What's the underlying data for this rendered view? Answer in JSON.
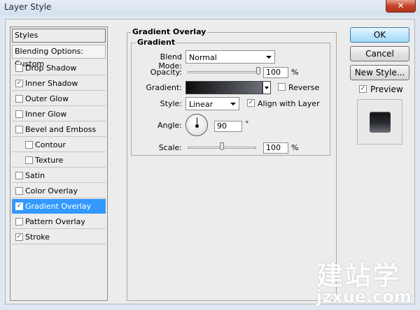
{
  "window": {
    "title": "Layer Style",
    "close_glyph": "✕"
  },
  "styles_list": {
    "header": "Styles",
    "blending_options": "Blending Options: Custom",
    "items": [
      {
        "label": "Drop Shadow",
        "checked": false,
        "selected": false
      },
      {
        "label": "Inner Shadow",
        "checked": true,
        "selected": false
      },
      {
        "label": "Outer Glow",
        "checked": false,
        "selected": false
      },
      {
        "label": "Inner Glow",
        "checked": false,
        "selected": false
      },
      {
        "label": "Bevel and Emboss",
        "checked": false,
        "selected": false
      },
      {
        "label": "Contour",
        "checked": false,
        "selected": false,
        "indent": true
      },
      {
        "label": "Texture",
        "checked": false,
        "selected": false,
        "indent": true
      },
      {
        "label": "Satin",
        "checked": false,
        "selected": false
      },
      {
        "label": "Color Overlay",
        "checked": false,
        "selected": false
      },
      {
        "label": "Gradient Overlay",
        "checked": true,
        "selected": true
      },
      {
        "label": "Pattern Overlay",
        "checked": false,
        "selected": false
      },
      {
        "label": "Stroke",
        "checked": true,
        "selected": false
      }
    ]
  },
  "gradient_overlay": {
    "title": "Gradient Overlay",
    "section": "Gradient",
    "blend_mode": {
      "label": "Blend Mode:",
      "value": "Normal"
    },
    "opacity": {
      "label": "Opacity:",
      "value": "100",
      "unit": "%",
      "level": 1.0
    },
    "gradient": {
      "label": "Gradient:",
      "colors": [
        "#0c0c0c",
        "#3a3c42",
        "#6b6e76"
      ]
    },
    "reverse": {
      "label": "Reverse",
      "checked": false
    },
    "style": {
      "label": "Style:",
      "value": "Linear"
    },
    "align": {
      "label": "Align with Layer",
      "checked": true
    },
    "angle": {
      "label": "Angle:",
      "value": "90",
      "unit": "°"
    },
    "scale": {
      "label": "Scale:",
      "value": "100",
      "unit": "%",
      "level": 0.5
    }
  },
  "buttons": {
    "ok": "OK",
    "cancel": "Cancel",
    "new_style": "New Style..."
  },
  "preview": {
    "label": "Preview",
    "checked": true
  },
  "icons": {
    "check": "✓"
  },
  "watermark": {
    "brand": "建站学",
    "domain": "jzxue.com"
  }
}
